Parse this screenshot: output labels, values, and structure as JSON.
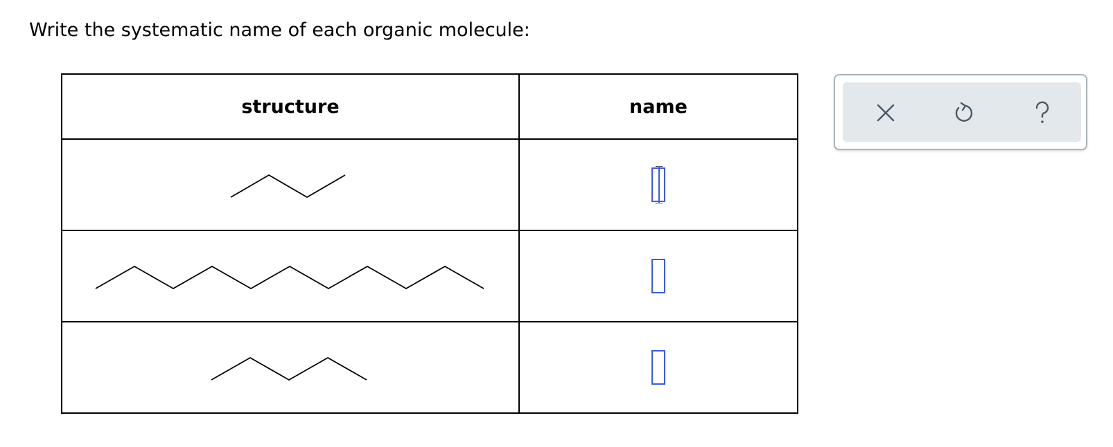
{
  "prompt": "Write the systematic name of each organic molecule:",
  "table": {
    "headers": {
      "structure": "structure",
      "name": "name"
    },
    "rows": [
      {
        "structure_icon": "skeletal-structure-4-carbon-chain",
        "name_value": ""
      },
      {
        "structure_icon": "skeletal-structure-10-carbon-chain",
        "name_value": ""
      },
      {
        "structure_icon": "skeletal-structure-4-carbon-chain",
        "name_value": ""
      }
    ]
  },
  "toolbar": {
    "icons": [
      "close-icon",
      "undo-icon",
      "help-icon"
    ]
  },
  "colors": {
    "input_border": "#3b5bdb",
    "toolbar_bg": "#e2e8ec",
    "toolbar_border": "#a8b4bd",
    "icon_color": "#4a5a66"
  }
}
